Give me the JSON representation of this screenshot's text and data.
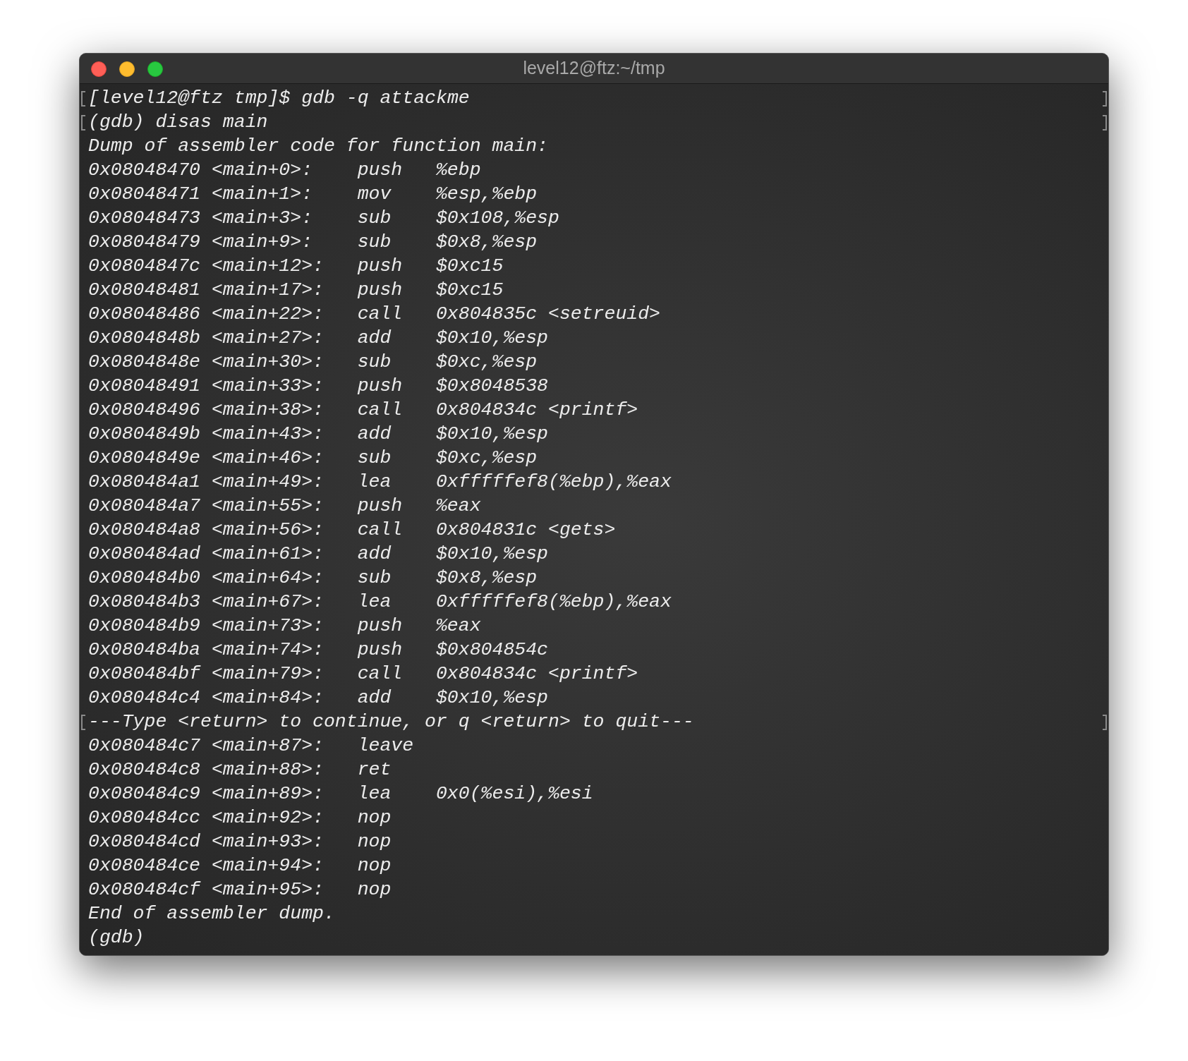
{
  "window": {
    "title": "level12@ftz:~/tmp"
  },
  "lines": [
    {
      "kind": "text",
      "text": "[level12@ftz tmp]$ gdb -q attackme",
      "marked": true
    },
    {
      "kind": "text",
      "text": "(gdb) disas main",
      "marked": true
    },
    {
      "kind": "text",
      "text": "Dump of assembler code for function main:",
      "marked": false
    },
    {
      "kind": "asm",
      "location": "0x08048470 <main+0>:",
      "op": "push",
      "args": "%ebp"
    },
    {
      "kind": "asm",
      "location": "0x08048471 <main+1>:",
      "op": "mov",
      "args": "%esp,%ebp"
    },
    {
      "kind": "asm",
      "location": "0x08048473 <main+3>:",
      "op": "sub",
      "args": "$0x108,%esp"
    },
    {
      "kind": "asm",
      "location": "0x08048479 <main+9>:",
      "op": "sub",
      "args": "$0x8,%esp"
    },
    {
      "kind": "asm",
      "location": "0x0804847c <main+12>:",
      "op": "push",
      "args": "$0xc15"
    },
    {
      "kind": "asm",
      "location": "0x08048481 <main+17>:",
      "op": "push",
      "args": "$0xc15"
    },
    {
      "kind": "asm",
      "location": "0x08048486 <main+22>:",
      "op": "call",
      "args": "0x804835c <setreuid>"
    },
    {
      "kind": "asm",
      "location": "0x0804848b <main+27>:",
      "op": "add",
      "args": "$0x10,%esp"
    },
    {
      "kind": "asm",
      "location": "0x0804848e <main+30>:",
      "op": "sub",
      "args": "$0xc,%esp"
    },
    {
      "kind": "asm",
      "location": "0x08048491 <main+33>:",
      "op": "push",
      "args": "$0x8048538"
    },
    {
      "kind": "asm",
      "location": "0x08048496 <main+38>:",
      "op": "call",
      "args": "0x804834c <printf>"
    },
    {
      "kind": "asm",
      "location": "0x0804849b <main+43>:",
      "op": "add",
      "args": "$0x10,%esp"
    },
    {
      "kind": "asm",
      "location": "0x0804849e <main+46>:",
      "op": "sub",
      "args": "$0xc,%esp"
    },
    {
      "kind": "asm",
      "location": "0x080484a1 <main+49>:",
      "op": "lea",
      "args": "0xfffffef8(%ebp),%eax"
    },
    {
      "kind": "asm",
      "location": "0x080484a7 <main+55>:",
      "op": "push",
      "args": "%eax"
    },
    {
      "kind": "asm",
      "location": "0x080484a8 <main+56>:",
      "op": "call",
      "args": "0x804831c <gets>"
    },
    {
      "kind": "asm",
      "location": "0x080484ad <main+61>:",
      "op": "add",
      "args": "$0x10,%esp"
    },
    {
      "kind": "asm",
      "location": "0x080484b0 <main+64>:",
      "op": "sub",
      "args": "$0x8,%esp"
    },
    {
      "kind": "asm",
      "location": "0x080484b3 <main+67>:",
      "op": "lea",
      "args": "0xfffffef8(%ebp),%eax"
    },
    {
      "kind": "asm",
      "location": "0x080484b9 <main+73>:",
      "op": "push",
      "args": "%eax"
    },
    {
      "kind": "asm",
      "location": "0x080484ba <main+74>:",
      "op": "push",
      "args": "$0x804854c"
    },
    {
      "kind": "asm",
      "location": "0x080484bf <main+79>:",
      "op": "call",
      "args": "0x804834c <printf>"
    },
    {
      "kind": "asm",
      "location": "0x080484c4 <main+84>:",
      "op": "add",
      "args": "$0x10,%esp"
    },
    {
      "kind": "text",
      "text": "---Type <return> to continue, or q <return> to quit---",
      "marked": true
    },
    {
      "kind": "asm",
      "location": "0x080484c7 <main+87>:",
      "op": "leave"
    },
    {
      "kind": "asm",
      "location": "0x080484c8 <main+88>:",
      "op": "ret"
    },
    {
      "kind": "asm",
      "location": "0x080484c9 <main+89>:",
      "op": "lea",
      "args": "0x0(%esi),%esi"
    },
    {
      "kind": "asm",
      "location": "0x080484cc <main+92>:",
      "op": "nop"
    },
    {
      "kind": "asm",
      "location": "0x080484cd <main+93>:",
      "op": "nop"
    },
    {
      "kind": "asm",
      "location": "0x080484ce <main+94>:",
      "op": "nop"
    },
    {
      "kind": "asm",
      "location": "0x080484cf <main+95>:",
      "op": "nop"
    },
    {
      "kind": "text",
      "text": "End of assembler dump.",
      "marked": false
    },
    {
      "kind": "text",
      "text": "(gdb)",
      "marked": false
    }
  ]
}
